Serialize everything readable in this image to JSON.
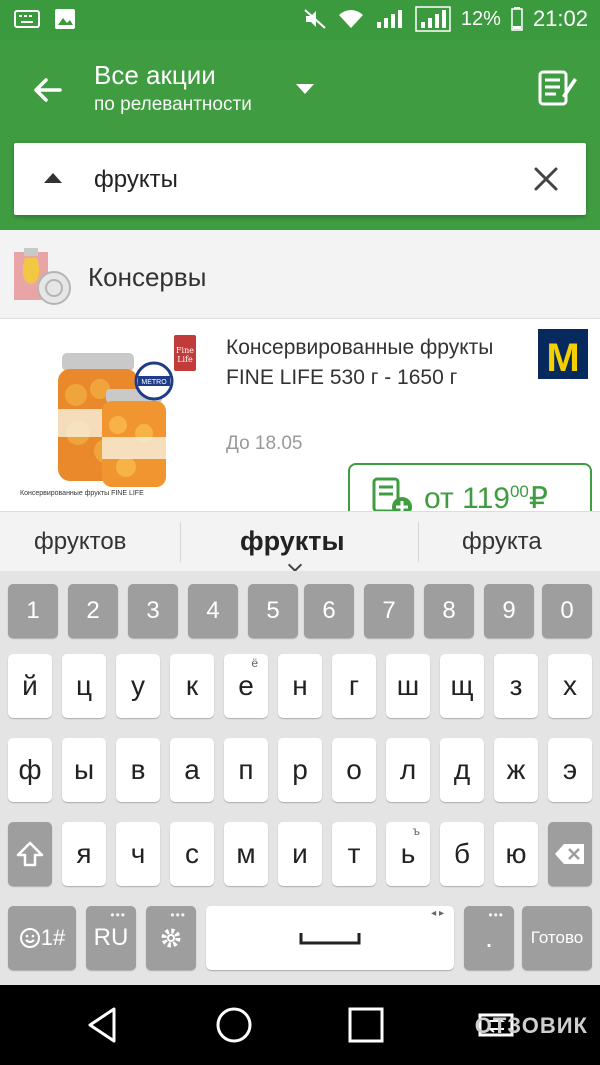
{
  "status": {
    "battery": "12%",
    "time": "21:02"
  },
  "header": {
    "title": "Все акции",
    "subtitle": "по релевантности"
  },
  "search": {
    "value": "фрукты",
    "placeholder": ""
  },
  "category": {
    "name": "Консервы"
  },
  "product": {
    "title": "Консервированные фрукты FINE LIFE 530 г - 1650 г",
    "date": "До 18.05",
    "price_prefix": "от ",
    "price_main": "119",
    "price_cents": "00",
    "currency": "₽",
    "store": "M",
    "image_caption": "Консервированные фрукты FINE LIFE"
  },
  "suggestions": [
    "фруктов",
    "фрукты",
    "фрукта"
  ],
  "keyboard": {
    "numbers": [
      "1",
      "2",
      "3",
      "4",
      "5",
      "6",
      "7",
      "8",
      "9",
      "0"
    ],
    "row1": [
      "й",
      "ц",
      "у",
      "к",
      "е",
      "н",
      "г",
      "ш",
      "щ",
      "з",
      "х"
    ],
    "row2": [
      "ф",
      "ы",
      "в",
      "а",
      "п",
      "р",
      "о",
      "л",
      "д",
      "ж",
      "э"
    ],
    "row3": [
      "я",
      "ч",
      "с",
      "м",
      "и",
      "т",
      "ь",
      "б",
      "ю"
    ],
    "hints": {
      "e": "ё",
      "soft": "ъ"
    },
    "symbols_label": "1#",
    "lang_label": "RU",
    "period": ".",
    "done_label": "Готово"
  },
  "watermark": "ОТЗОВИК",
  "colors": {
    "primary": "#3f9c41",
    "metro": "#062a5e",
    "metro_yellow": "#f4d000"
  }
}
